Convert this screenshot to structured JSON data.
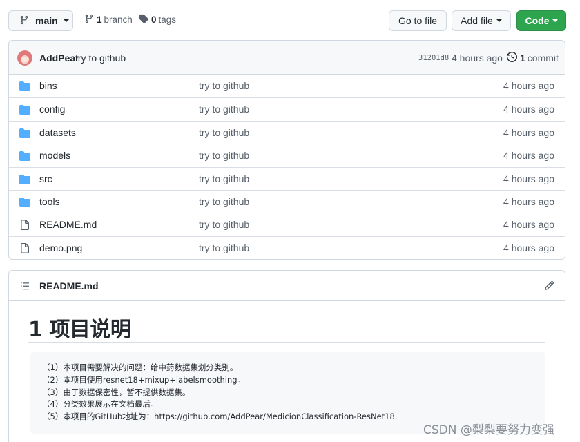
{
  "toolbar": {
    "branch_name": "main",
    "branch_count": "1",
    "branch_label": "branch",
    "tag_count": "0",
    "tag_label": "tags",
    "goto_file_label": "Go to file",
    "add_file_label": "Add file",
    "code_label": "Code"
  },
  "commit": {
    "author": "AddPear",
    "message": "try to github",
    "sha": "31201d8",
    "time": "4 hours ago",
    "count": "1",
    "count_label": "commit"
  },
  "files": [
    {
      "name": "bins",
      "type": "folder",
      "message": "try to github",
      "age": "4 hours ago"
    },
    {
      "name": "config",
      "type": "folder",
      "message": "try to github",
      "age": "4 hours ago"
    },
    {
      "name": "datasets",
      "type": "folder",
      "message": "try to github",
      "age": "4 hours ago"
    },
    {
      "name": "models",
      "type": "folder",
      "message": "try to github",
      "age": "4 hours ago"
    },
    {
      "name": "src",
      "type": "folder",
      "message": "try to github",
      "age": "4 hours ago"
    },
    {
      "name": "tools",
      "type": "folder",
      "message": "try to github",
      "age": "4 hours ago"
    },
    {
      "name": "README.md",
      "type": "file",
      "message": "try to github",
      "age": "4 hours ago"
    },
    {
      "name": "demo.png",
      "type": "file",
      "message": "try to github",
      "age": "4 hours ago"
    }
  ],
  "readme": {
    "filename": "README.md",
    "heading": "1 项目说明",
    "lines": [
      "（1）本项目需要解决的问题：给中药数据集划分类别。",
      "（2）本项目使用resnet18+mixup+labelsmoothing。",
      "（3）由于数据保密性，暂不提供数据集。",
      "（4）分类效果展示在文档最后。",
      "（5）本项目的GitHub地址为：https://github.com/AddPear/MedicionClassification-ResNet18"
    ]
  },
  "watermark": "CSDN @梨梨要努力变强",
  "colors": {
    "folder": "#54aeff",
    "code_button": "#2da44e",
    "border": "#d0d7de",
    "muted_text": "#57606a"
  }
}
